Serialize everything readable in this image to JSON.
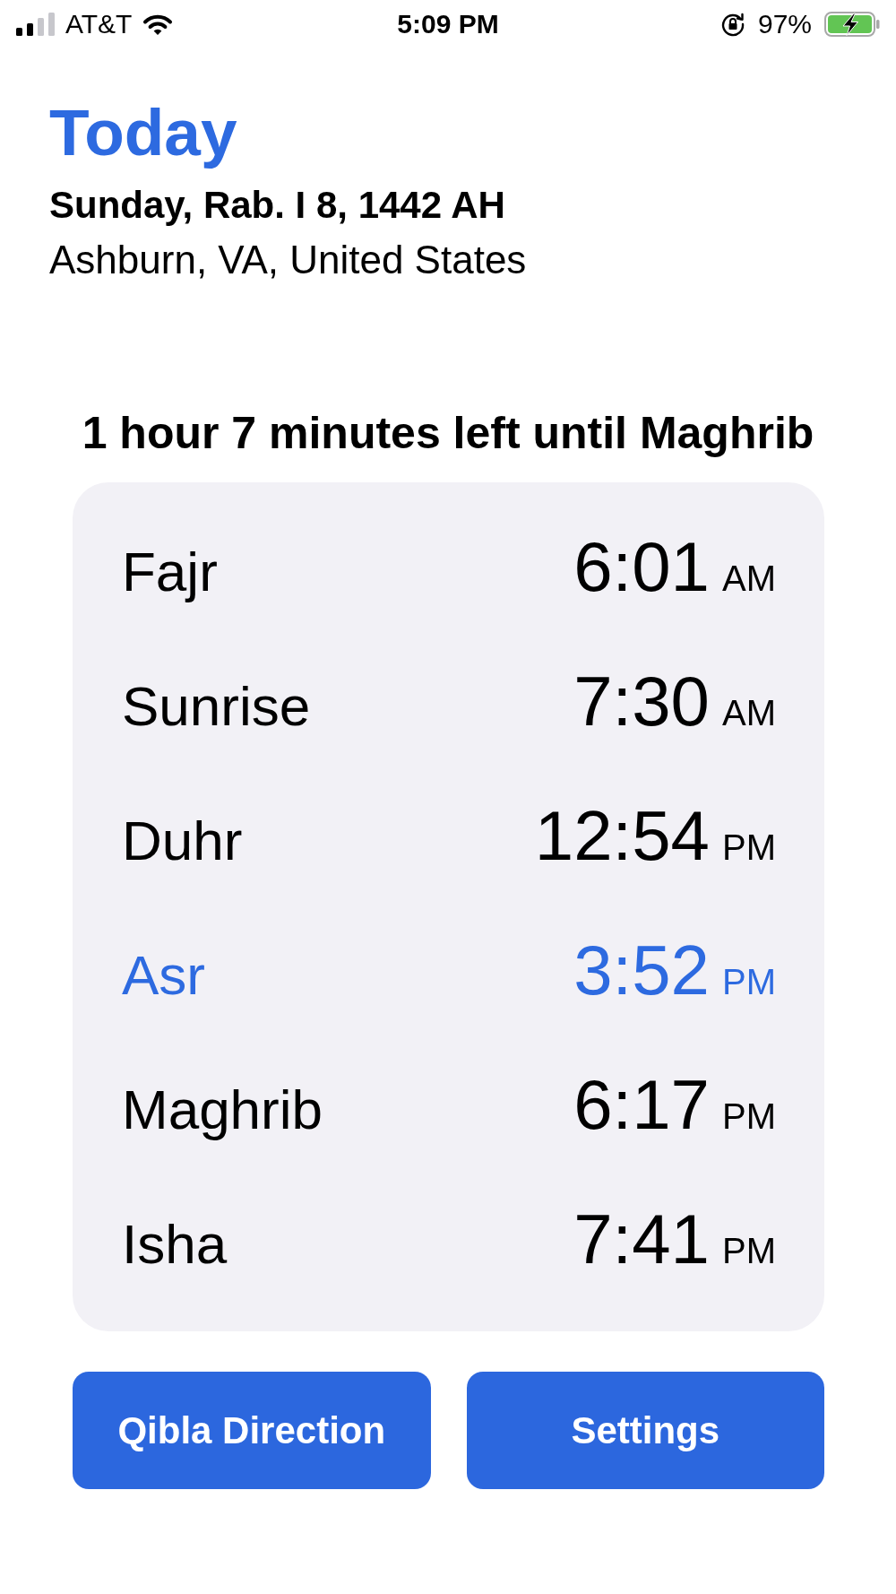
{
  "status_bar": {
    "carrier": "AT&T",
    "time": "5:09 PM",
    "battery": "97%"
  },
  "header": {
    "title": "Today",
    "date": "Sunday, Rab. I 8, 1442 AH",
    "location": "Ashburn, VA, United States"
  },
  "countdown": "1 hour 7 minutes left until Maghrib",
  "prayers": [
    {
      "name": "Fajr",
      "time": "6:01",
      "period": "AM",
      "current": false
    },
    {
      "name": "Sunrise",
      "time": "7:30",
      "period": "AM",
      "current": false
    },
    {
      "name": "Duhr",
      "time": "12:54",
      "period": "PM",
      "current": false
    },
    {
      "name": "Asr",
      "time": "3:52",
      "period": "PM",
      "current": true
    },
    {
      "name": "Maghrib",
      "time": "6:17",
      "period": "PM",
      "current": false
    },
    {
      "name": "Isha",
      "time": "7:41",
      "period": "PM",
      "current": false
    }
  ],
  "buttons": [
    {
      "label": "Qibla Direction"
    },
    {
      "label": "Settings"
    }
  ]
}
